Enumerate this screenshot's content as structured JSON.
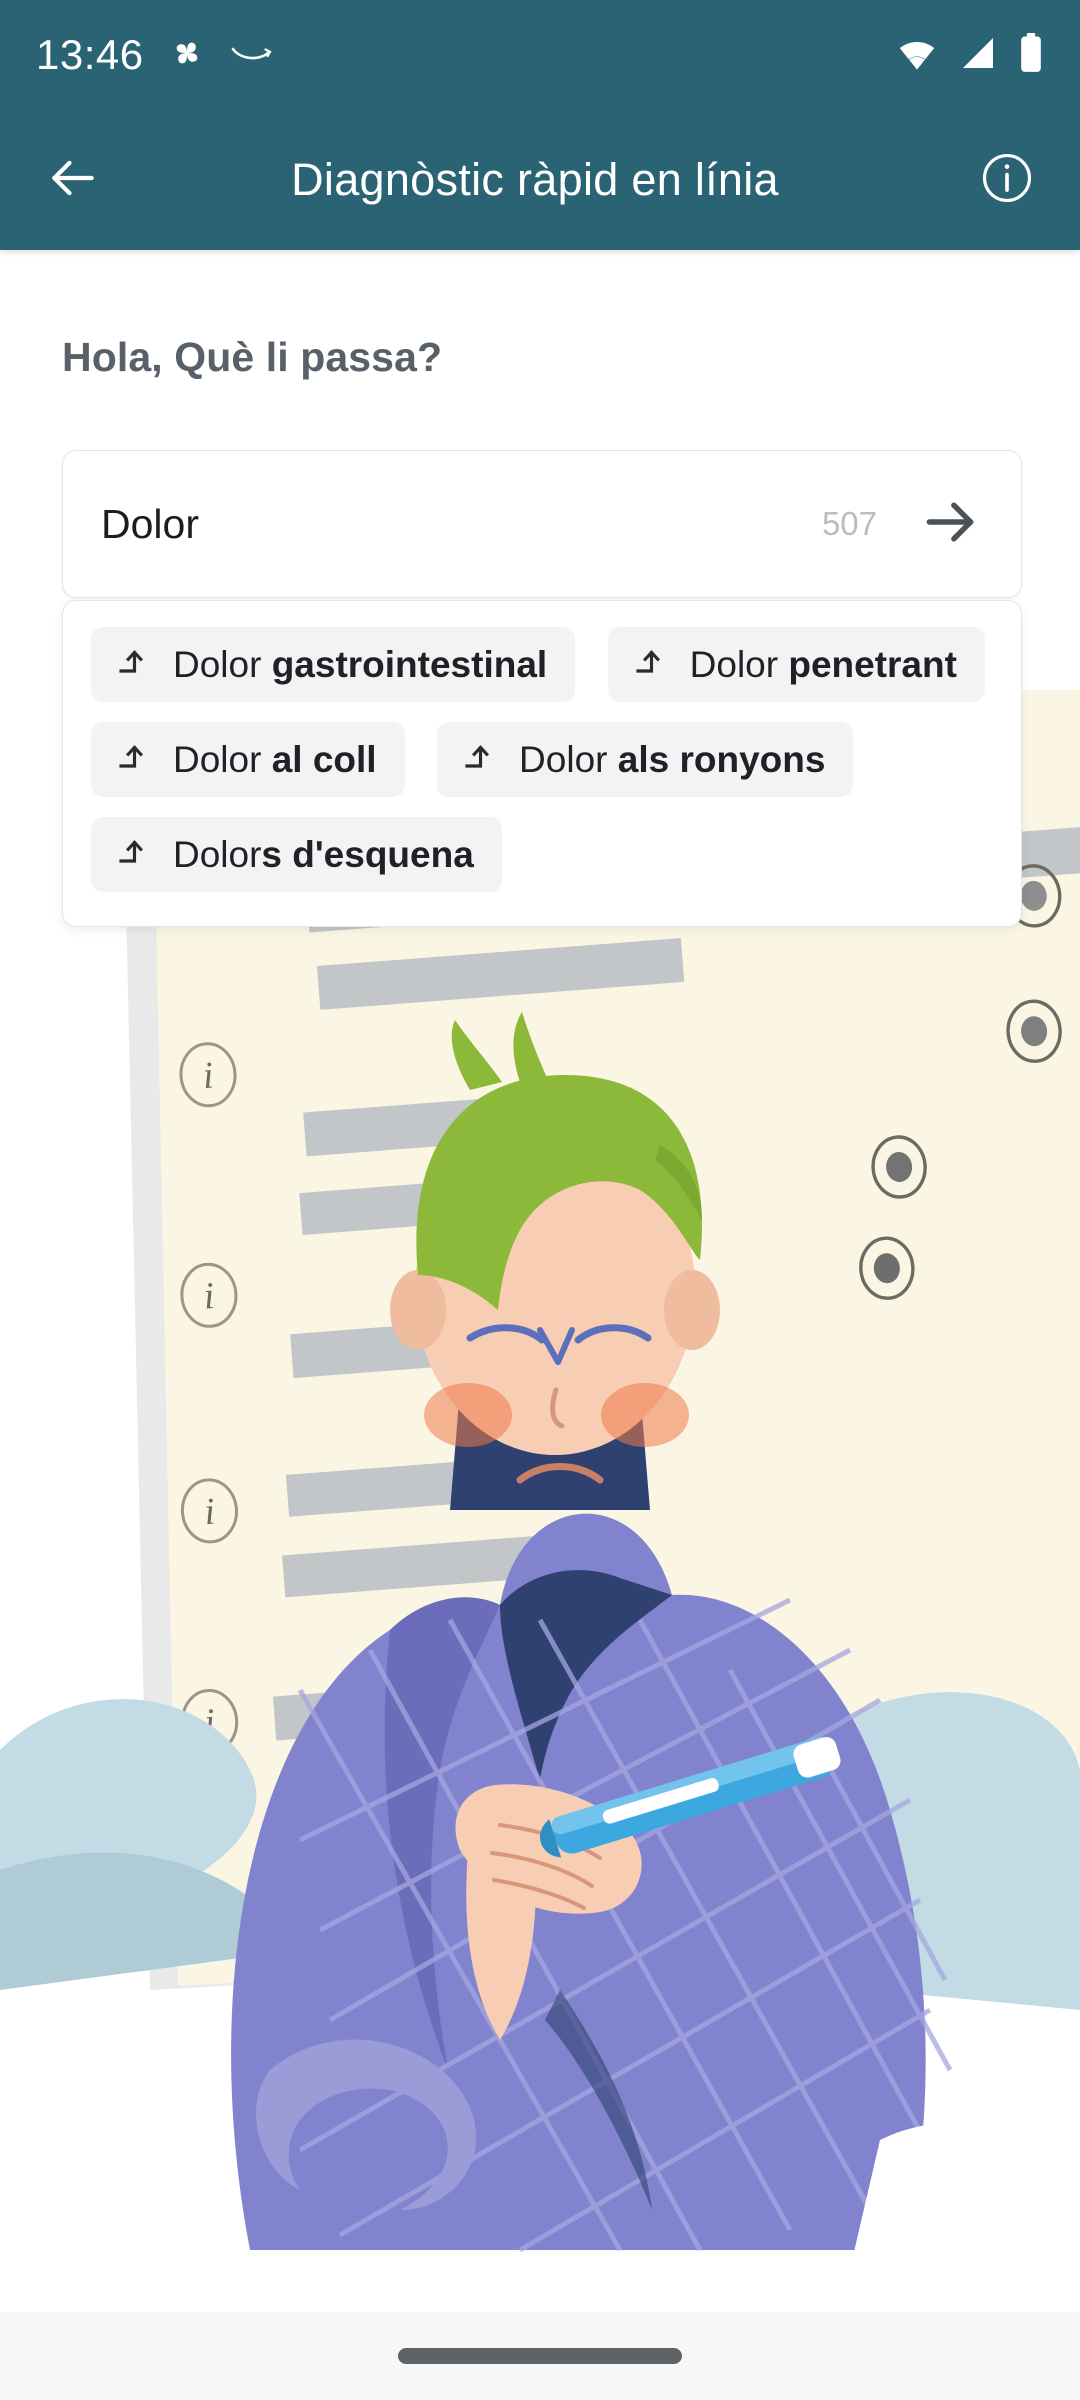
{
  "status_bar": {
    "time": "13:46",
    "left_icons": [
      {
        "name": "pinwheel-icon"
      },
      {
        "name": "amazon-smile-icon"
      }
    ],
    "right_icons": [
      {
        "name": "wifi-icon"
      },
      {
        "name": "cellular-signal-icon"
      },
      {
        "name": "battery-icon"
      }
    ]
  },
  "app_bar": {
    "back_label": "back-arrow-icon",
    "title": "Diagnòstic ràpid en línia",
    "info_label": "info-icon",
    "background_color": "#2a6474",
    "text_color": "#ffffff"
  },
  "main": {
    "greeting": "Hola, Què li passa?",
    "search": {
      "value": "Dolor",
      "placeholder": "Dolor",
      "char_count": "507",
      "submit_icon": "arrow-right-icon"
    },
    "suggestions": [
      {
        "icon": "arrow-turn-up-icon",
        "prefix": "Dolor ",
        "completion": "gastrointestinal"
      },
      {
        "icon": "arrow-turn-up-icon",
        "prefix": "Dolor ",
        "completion": "penetrant"
      },
      {
        "icon": "arrow-turn-up-icon",
        "prefix": "Dolor ",
        "completion": "al coll"
      },
      {
        "icon": "arrow-turn-up-icon",
        "prefix": "Dolor ",
        "completion": "als ronyons"
      },
      {
        "icon": "arrow-turn-up-icon",
        "prefix": "Dolor",
        "completion": "s d'esquena"
      }
    ]
  },
  "illustration": {
    "name": "sick-person-with-thermometer-illustration",
    "description": "Tilted cream questionnaire form with grey placeholder text bars, info icons and radio buttons, in front of it a person with green hair wrapped in a purple plaid blanket holding a blue thermometer, seated against light blue pillows",
    "colors": {
      "paper": "#fbf6e4",
      "paper_edge": "#e6e6e6",
      "text_bar": "#c3c6c8",
      "blanket": "#8183ce",
      "blanket_dark": "#4e5b9b",
      "skin": "#f7cdb3",
      "hair": "#8cb939",
      "pillow": "#c3dbe4",
      "thermometer": "#3da7e0"
    }
  },
  "nav_bar": {
    "handle": "gesture-nav-handle"
  }
}
